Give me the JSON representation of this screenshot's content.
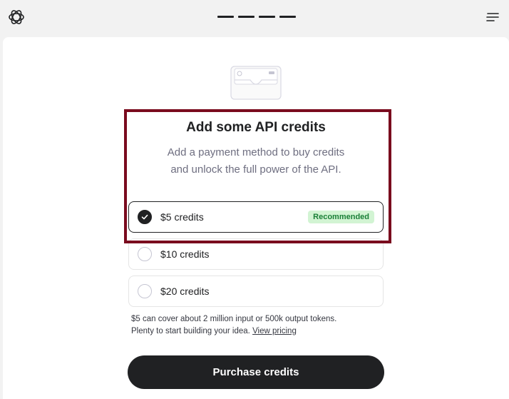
{
  "header": {
    "logo_icon": "openai-logo-icon",
    "progress_steps": 4,
    "menu_icon": "menu-icon"
  },
  "illustration": {
    "icon": "wallet-card-icon"
  },
  "main": {
    "title": "Add some API credits",
    "subtitle_line1": "Add a payment method to buy credits",
    "subtitle_line2": "and unlock the full power of the API.",
    "options": [
      {
        "label": "$5 credits",
        "selected": true,
        "badge": "Recommended"
      },
      {
        "label": "$10 credits",
        "selected": false
      },
      {
        "label": "$20 credits",
        "selected": false
      }
    ],
    "note_line1": "$5 can cover about 2 million input or 500k output tokens.",
    "note_line2": "Plenty to start building your idea.",
    "note_link": "View pricing",
    "purchase_label": "Purchase credits"
  },
  "colors": {
    "highlight": "#7a0b1e",
    "badge_bg": "#d2f4d3",
    "badge_text": "#1a7f37",
    "button_bg": "#202123"
  }
}
